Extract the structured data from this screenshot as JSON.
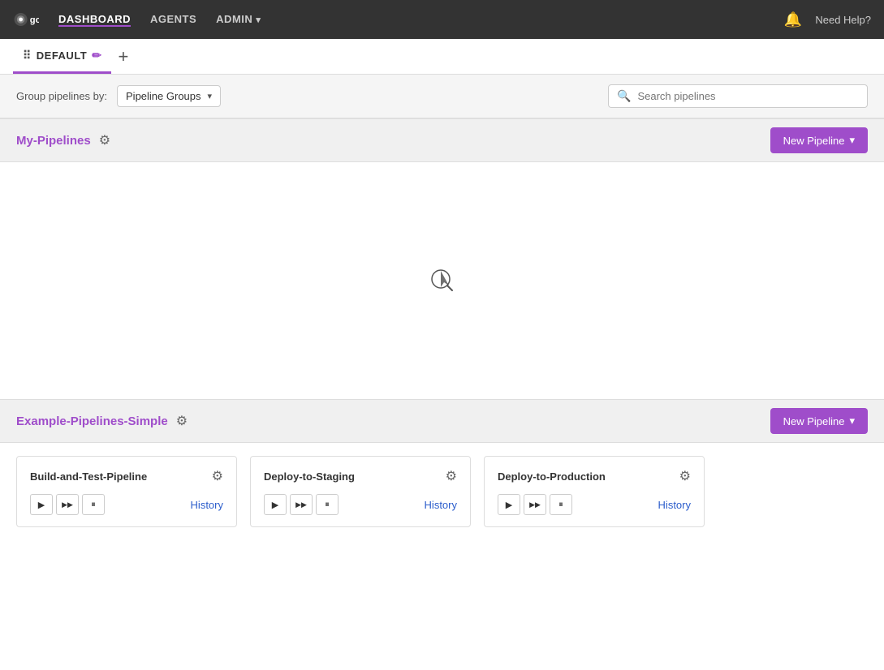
{
  "nav": {
    "logo_text": "go",
    "links": [
      {
        "id": "dashboard",
        "label": "DASHBOARD",
        "active": true
      },
      {
        "id": "agents",
        "label": "AGENTS",
        "active": false
      },
      {
        "id": "admin",
        "label": "ADMIN",
        "active": false,
        "has_dropdown": true
      }
    ],
    "need_help": "Need Help?"
  },
  "tabs": [
    {
      "id": "default",
      "label": "DEFAULT",
      "active": true
    }
  ],
  "tab_add_label": "+",
  "filter": {
    "group_by_label": "Group pipelines by:",
    "group_by_value": "Pipeline Groups",
    "search_placeholder": "Search pipelines"
  },
  "pipeline_groups": [
    {
      "id": "my-pipelines",
      "title": "My-Pipelines",
      "new_pipeline_label": "New Pipeline",
      "loading": true,
      "pipelines": []
    },
    {
      "id": "example-pipelines-simple",
      "title": "Example-Pipelines-Simple",
      "new_pipeline_label": "New Pipeline",
      "loading": false,
      "pipelines": [
        {
          "id": "build-and-test",
          "name": "Build-and-Test-Pipeline",
          "history_label": "History"
        },
        {
          "id": "deploy-to-staging",
          "name": "Deploy-to-Staging",
          "history_label": "History"
        },
        {
          "id": "deploy-to-production",
          "name": "Deploy-to-Production",
          "history_label": "History"
        }
      ]
    }
  ],
  "icons": {
    "play": "▶",
    "play_skip": "▶▶",
    "pause": "⏸",
    "gear": "⚙",
    "chevron_down": "▾",
    "search": "🔍",
    "bell": "🔔",
    "grid": "⠿",
    "pencil": "✏"
  },
  "colors": {
    "brand_purple": "#9f4dca",
    "nav_bg": "#333333",
    "link_blue": "#2b5dcc"
  }
}
